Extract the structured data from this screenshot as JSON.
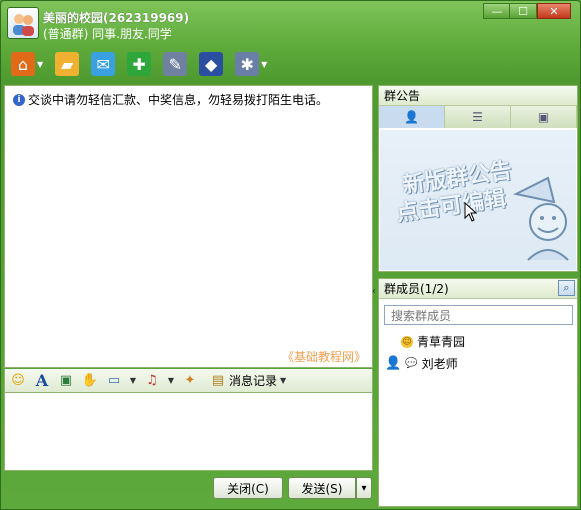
{
  "window": {
    "title_name": "美丽的校园(262319969)",
    "title_sub": "(普通群) 同事.朋友.同学",
    "controls": [
      "—",
      "☐",
      "✕"
    ]
  },
  "toolbar": {
    "items": [
      {
        "name": "home-icon",
        "glyph": "⌂",
        "color": "#e06a18",
        "dropdown": true
      },
      {
        "name": "folder-icon",
        "glyph": "▰",
        "color": "#f0b030",
        "dropdown": false
      },
      {
        "name": "mail-icon",
        "glyph": "✉",
        "color": "#3aa0e0",
        "dropdown": false
      },
      {
        "name": "add-app-icon",
        "glyph": "✚",
        "color": "#2ea63a",
        "dropdown": false
      },
      {
        "name": "tools-icon",
        "glyph": "✎",
        "color": "#7080a0",
        "dropdown": false
      },
      {
        "name": "police-hat-icon",
        "glyph": "◆",
        "color": "#2a4fa0",
        "dropdown": false
      },
      {
        "name": "settings-icon",
        "glyph": "✱",
        "color": "#6a7fa8",
        "dropdown": true
      }
    ]
  },
  "chat": {
    "notice": "交谈中请勿轻信汇款、中奖信息，勿轻易拨打陌生电话。",
    "watermark": "《基础教程网》"
  },
  "input_toolbar": {
    "history_label": "消息记录"
  },
  "buttons": {
    "close": "关闭(C)",
    "send": "发送(S)",
    "send_menu": "▾"
  },
  "announcement": {
    "header": "群公告",
    "tabs": [
      "👤",
      "☰",
      "▣"
    ],
    "art_line1": "新版群公告",
    "art_line2": "点击可编辑"
  },
  "members": {
    "header": "群成员(1/2)",
    "search_placeholder": "搜索群成员",
    "list": [
      {
        "name": "青草青园"
      },
      {
        "name": "刘老师"
      }
    ]
  }
}
